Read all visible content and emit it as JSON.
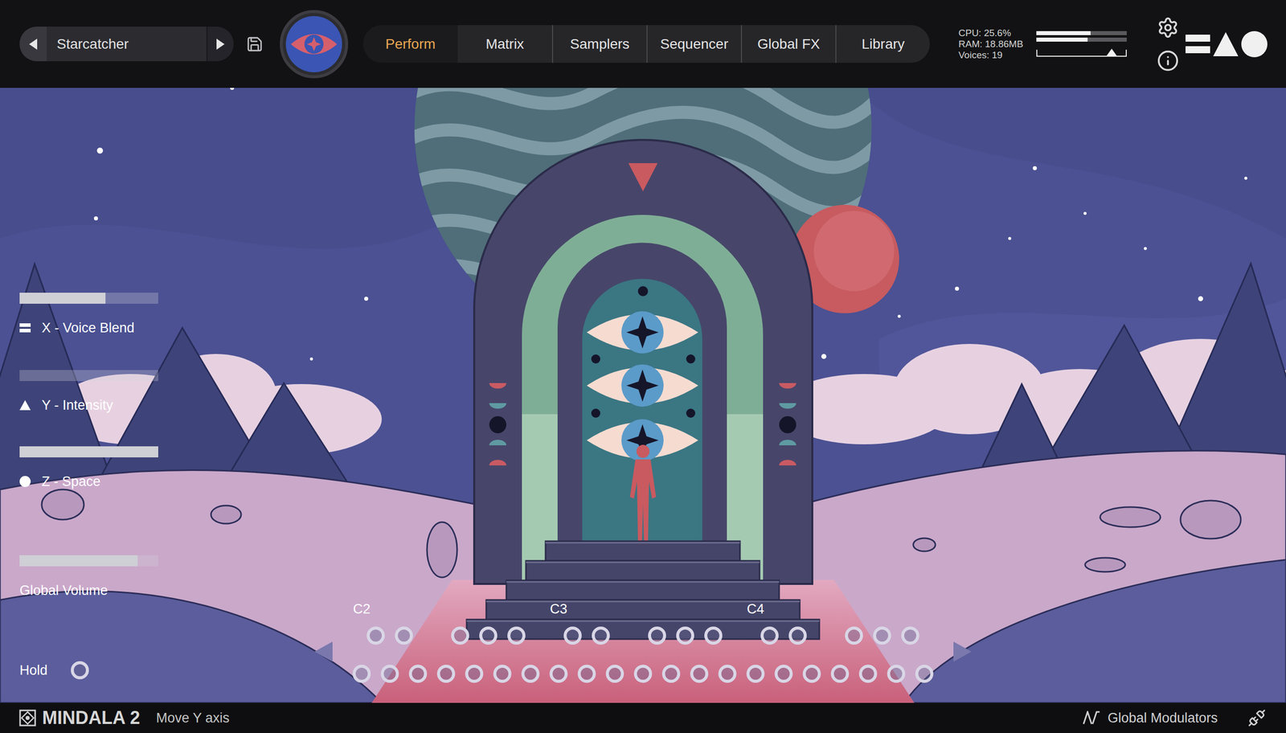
{
  "preset": {
    "name": "Starcatcher"
  },
  "tabs": [
    {
      "label": "Perform",
      "selected": true
    },
    {
      "label": "Matrix",
      "selected": false
    },
    {
      "label": "Samplers",
      "selected": false
    },
    {
      "label": "Sequencer",
      "selected": false
    },
    {
      "label": "Global FX",
      "selected": false
    },
    {
      "label": "Library",
      "selected": false
    }
  ],
  "stats": {
    "cpu": "CPU: 25.6%",
    "ram": "RAM: 18.86MB",
    "voices": "Voices: 19"
  },
  "meters": {
    "left": 0.6,
    "right": 0.57,
    "output": 0.84
  },
  "macros": [
    {
      "label": "X - Voice Blend",
      "level": 0.62,
      "kind": "bars"
    },
    {
      "label": "Y - Intensity",
      "level": 0.0,
      "kind": "triangle"
    },
    {
      "label": "Z - Space",
      "level": 1.0,
      "kind": "circle"
    },
    {
      "label": "Global Volume",
      "level": 0.85,
      "kind": "none"
    }
  ],
  "hold": {
    "label": "Hold",
    "on": false
  },
  "keyboard": {
    "octaves": [
      "C2",
      "C3",
      "C4"
    ]
  },
  "status_bar": {
    "brand": "MINDALA 2",
    "hint": "Move Y axis",
    "modulators": "Global Modulators"
  }
}
